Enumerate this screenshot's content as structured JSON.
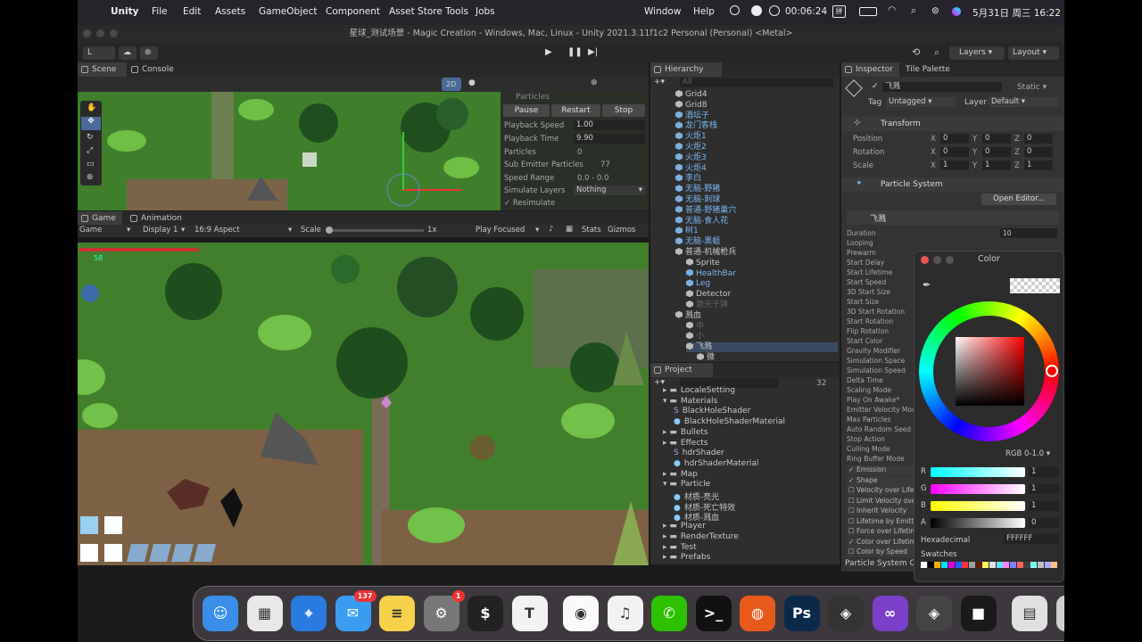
{
  "menubar": {
    "app": "Unity",
    "items": [
      "File",
      "Edit",
      "Assets",
      "GameObject",
      "Component",
      "Asset Store Tools",
      "Jobs",
      "Window",
      "Help"
    ],
    "timer": "00:06:24",
    "clock": "5月31日 周三 16:22"
  },
  "window": {
    "title": "星球_测试场景 - Magic Creation - Windows, Mac, Linux - Unity 2021.3.11f1c2 Personal (Personal) <Metal>"
  },
  "toolbar": {
    "account": "L",
    "layers": "Layers",
    "layout": "Layout"
  },
  "tabs": {
    "scene": "Scene",
    "console": "Console",
    "game": "Game",
    "animation": "Animation",
    "hierarchy": "Hierarchy",
    "project": "Project",
    "inspector": "Inspector",
    "tile_palette": "Tile Palette"
  },
  "scene": {
    "mode": "2D"
  },
  "particles": {
    "title": "Particles",
    "pause": "Pause",
    "restart": "Restart",
    "stop": "Stop",
    "rows": [
      {
        "label": "Playback Speed",
        "value": "1.00"
      },
      {
        "label": "Playback Time",
        "value": "9.90"
      },
      {
        "label": "Particles",
        "value": "0"
      },
      {
        "label": "Sub Emitter Particles",
        "value": "77"
      },
      {
        "label": "Speed Range",
        "value": "0.0 - 0.0"
      },
      {
        "label": "Simulate Layers",
        "value": "Nothing"
      }
    ],
    "resimulate": "Resimulate"
  },
  "game": {
    "view": "Game",
    "display": "Display 1",
    "aspect": "16:9 Aspect",
    "scale_label": "Scale",
    "scale_value": "1x",
    "play_mode": "Play Focused",
    "stats": "Stats",
    "gizmos": "Gizmos",
    "hud_counter": "58"
  },
  "hierarchy": {
    "search_placeholder": "All",
    "items": [
      {
        "label": "Grid4",
        "indent": 0,
        "style": "normal"
      },
      {
        "label": "Grid8",
        "indent": 0,
        "style": "normal"
      },
      {
        "label": "酒坛子",
        "indent": 0,
        "style": "blue"
      },
      {
        "label": "龙门客栈",
        "indent": 0,
        "style": "blue"
      },
      {
        "label": "火炬1",
        "indent": 0,
        "style": "blue"
      },
      {
        "label": "火炬2",
        "indent": 0,
        "style": "blue"
      },
      {
        "label": "火炬3",
        "indent": 0,
        "style": "blue"
      },
      {
        "label": "火炬4",
        "indent": 0,
        "style": "blue"
      },
      {
        "label": "李白",
        "indent": 0,
        "style": "blue"
      },
      {
        "label": "无脑-野猪",
        "indent": 0,
        "style": "blue"
      },
      {
        "label": "无脑-刺球",
        "indent": 0,
        "style": "blue"
      },
      {
        "label": "普通-野猪巢穴",
        "indent": 0,
        "style": "blue"
      },
      {
        "label": "无脑-食人花",
        "indent": 0,
        "style": "blue"
      },
      {
        "label": "树1",
        "indent": 0,
        "style": "blue"
      },
      {
        "label": "无脑-黑蛆",
        "indent": 0,
        "style": "blue"
      },
      {
        "label": "普通-机械枪兵",
        "indent": 0,
        "style": "normal"
      },
      {
        "label": "Sprite",
        "indent": 1,
        "style": "normal"
      },
      {
        "label": "HealthBar",
        "indent": 1,
        "style": "blue"
      },
      {
        "label": "Leg",
        "indent": 1,
        "style": "blue"
      },
      {
        "label": "Detector",
        "indent": 1,
        "style": "normal"
      },
      {
        "label": "激光子弹",
        "indent": 1,
        "style": "grey"
      },
      {
        "label": "溅血",
        "indent": 0,
        "style": "normal"
      },
      {
        "label": "中",
        "indent": 1,
        "style": "grey"
      },
      {
        "label": "小",
        "indent": 1,
        "style": "grey"
      },
      {
        "label": "飞溅",
        "indent": 1,
        "style": "selected"
      },
      {
        "label": "微",
        "indent": 2,
        "style": "normal"
      }
    ]
  },
  "project": {
    "hidden_count": "32",
    "items": [
      {
        "label": "LocaleSetting",
        "indent": 0,
        "kind": "folder"
      },
      {
        "label": "Materials",
        "indent": 0,
        "kind": "folder-open"
      },
      {
        "label": "BlackHoleShader",
        "indent": 1,
        "kind": "shader"
      },
      {
        "label": "BlackHoleShaderMaterial",
        "indent": 1,
        "kind": "material"
      },
      {
        "label": "Bullets",
        "indent": 0,
        "kind": "folder"
      },
      {
        "label": "Effects",
        "indent": 0,
        "kind": "folder"
      },
      {
        "label": "hdrShader",
        "indent": 1,
        "kind": "shader"
      },
      {
        "label": "hdrShaderMaterial",
        "indent": 1,
        "kind": "material"
      },
      {
        "label": "Map",
        "indent": 0,
        "kind": "folder"
      },
      {
        "label": "Particle",
        "indent": 0,
        "kind": "folder-open"
      },
      {
        "label": "材质-亮光",
        "indent": 1,
        "kind": "material"
      },
      {
        "label": "材质-死亡特效",
        "indent": 1,
        "kind": "material"
      },
      {
        "label": "材质-溅血",
        "indent": 1,
        "kind": "material"
      },
      {
        "label": "Player",
        "indent": 0,
        "kind": "folder"
      },
      {
        "label": "RenderTexture",
        "indent": 0,
        "kind": "folder"
      },
      {
        "label": "Test",
        "indent": 0,
        "kind": "folder"
      },
      {
        "label": "Prefabs",
        "indent": 0,
        "kind": "folder"
      }
    ]
  },
  "inspector": {
    "object_name": "飞溅",
    "static": "Static ▾",
    "tag_label": "Tag",
    "tag": "Untagged",
    "layer_label": "Layer",
    "layer": "Default",
    "transform": {
      "title": "Transform",
      "rows": [
        {
          "label": "Position",
          "x": "0",
          "y": "0",
          "z": "0"
        },
        {
          "label": "Rotation",
          "x": "0",
          "y": "0",
          "z": "0"
        },
        {
          "label": "Scale",
          "x": "1",
          "y": "1",
          "z": "1"
        }
      ]
    },
    "particle_system": {
      "title": "Particle System",
      "open_editor": "Open Editor...",
      "module_name": "飞溅",
      "duration_value": "10",
      "properties": [
        "Duration",
        "Looping",
        "Prewarm",
        "Start Delay",
        "Start Lifetime",
        "Start Speed",
        "3D Start Size",
        "Start Size",
        "3D Start Rotation",
        "Start Rotation",
        "Flip Rotation",
        "Start Color",
        "Gravity Modifier",
        "Simulation Space",
        "Simulation Speed",
        "Delta Time",
        "Scaling Mode",
        "Play On Awake*",
        "Emitter Velocity Mode",
        "Max Particles",
        "Auto Random Seed",
        "Stop Action",
        "Culling Mode",
        "Ring Buffer Mode"
      ],
      "modules": [
        {
          "label": "Emission",
          "checked": true
        },
        {
          "label": "Shape",
          "checked": true
        },
        {
          "label": "Velocity over Lifetime",
          "checked": false
        },
        {
          "label": "Limit Velocity over Lifetime",
          "checked": false
        },
        {
          "label": "Inherit Velocity",
          "checked": false
        },
        {
          "label": "Lifetime by Emitter Speed",
          "checked": false
        },
        {
          "label": "Force over Lifetime",
          "checked": false
        },
        {
          "label": "Color over Lifetime",
          "checked": true
        },
        {
          "label": "Color by Speed",
          "checked": false
        }
      ],
      "curves_label": "Particle System Curves"
    }
  },
  "colorpicker": {
    "title": "Color",
    "mode": "RGB 0-1.0",
    "channels": [
      {
        "label": "R",
        "value": "1",
        "gradient": "linear-gradient(to right,#0ff,#fff)"
      },
      {
        "label": "G",
        "value": "1",
        "gradient": "linear-gradient(to right,#f0f,#fff)"
      },
      {
        "label": "B",
        "value": "1",
        "gradient": "linear-gradient(to right,#ff0,#fff)"
      },
      {
        "label": "A",
        "value": "0",
        "gradient": "linear-gradient(to right,#000,#fff)"
      }
    ],
    "hex_label": "Hexadecimal",
    "hex": "FFFFFF",
    "swatches_label": "Swatches",
    "swatches": [
      "#ffffff",
      "#000000",
      "#f0b000",
      "#00e0ff",
      "#e000e0",
      "#2060ff",
      "#ff3030",
      "#a0a0a0",
      "#602000",
      "#ffff60",
      "#e0e0e0",
      "#60e0ff",
      "#ff80ff",
      "#8080ff",
      "#ff6060",
      "#404040",
      "#80ffff",
      "#c0c0c0",
      "#aaaaff",
      "#ffc080"
    ]
  },
  "dock": {
    "apps": [
      {
        "name": "finder-icon",
        "color": "#3a8ee8",
        "glyph": "☺"
      },
      {
        "name": "launchpad-icon",
        "color": "#e8e8e8",
        "glyph": "▦"
      },
      {
        "name": "safari-icon",
        "color": "#2a7be0",
        "glyph": "⌖"
      },
      {
        "name": "mail-icon",
        "color": "#3a9cf0",
        "glyph": "✉",
        "badge": "137"
      },
      {
        "name": "notes-icon",
        "color": "#f5d24a",
        "glyph": "≡"
      },
      {
        "name": "system-settings-icon",
        "color": "#777",
        "glyph": "⚙",
        "badge": "1"
      },
      {
        "name": "terminal-icon",
        "color": "#222",
        "glyph": "$"
      },
      {
        "name": "typora-icon",
        "color": "#f2f2f2",
        "glyph": "T"
      },
      {
        "name": "qq-icon",
        "color": "#fafafa",
        "glyph": "◉"
      },
      {
        "name": "netease-music-icon",
        "color": "#f2f2f2",
        "glyph": "♫"
      },
      {
        "name": "wechat-icon",
        "color": "#2dc100",
        "glyph": "✆"
      },
      {
        "name": "iterm-icon",
        "color": "#111",
        "glyph": ">_"
      },
      {
        "name": "firefox-icon",
        "color": "#e85a1c",
        "glyph": "◍"
      },
      {
        "name": "photoshop-icon",
        "color": "#0b2a4a",
        "glyph": "Ps"
      },
      {
        "name": "unity-hub-icon",
        "color": "#333",
        "glyph": "◈"
      },
      {
        "name": "visual-studio-icon",
        "color": "#7a40c8",
        "glyph": "∞"
      },
      {
        "name": "unity-icon",
        "color": "#444",
        "glyph": "◈"
      },
      {
        "name": "screen-recorder-icon",
        "color": "#1a1a1a",
        "glyph": "■"
      },
      {
        "name": "preview-icon",
        "color": "#e0e0e0",
        "glyph": "▤"
      },
      {
        "name": "trash-icon",
        "color": "#d0d0d0",
        "glyph": "🗑"
      }
    ]
  }
}
